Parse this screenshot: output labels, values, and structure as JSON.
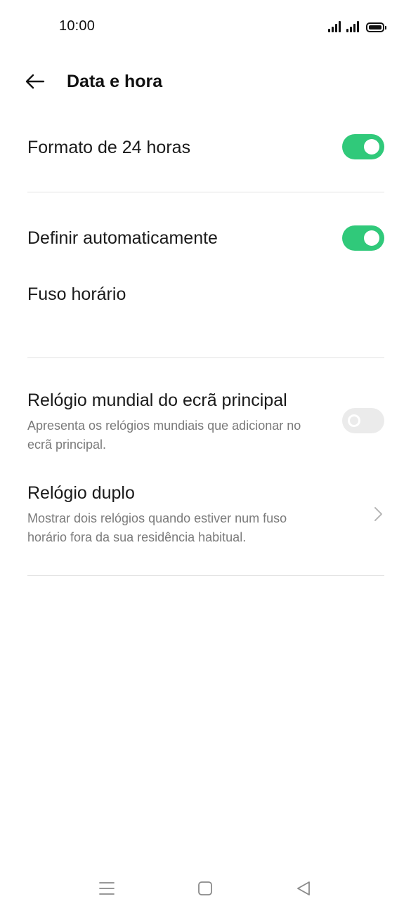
{
  "status_bar": {
    "time": "10:00"
  },
  "header": {
    "title": "Data e hora"
  },
  "settings": {
    "format_24h": {
      "title": "Formato de 24 horas",
      "enabled": true
    },
    "auto_set": {
      "title": "Definir automaticamente",
      "enabled": true
    },
    "timezone": {
      "title": "Fuso horário"
    },
    "world_clock": {
      "title": "Relógio mundial do ecrã principal",
      "subtitle": "Apresenta os relógios mundiais que adicionar no ecrã principal.",
      "enabled": false
    },
    "dual_clock": {
      "title": "Relógio duplo",
      "subtitle": "Mostrar dois relógios quando estiver num fuso horário fora da sua residência habitual."
    }
  },
  "colors": {
    "toggle_on": "#30c97a",
    "toggle_off": "#ebebeb",
    "divider": "#e4e4e4",
    "subtitle_text": "#7a7a7a"
  },
  "icons": {
    "back": "arrow-left-icon",
    "chevron": "chevron-right-icon",
    "nav_menu": "menu-icon",
    "nav_home": "home-square-icon",
    "nav_back": "triangle-back-icon"
  }
}
